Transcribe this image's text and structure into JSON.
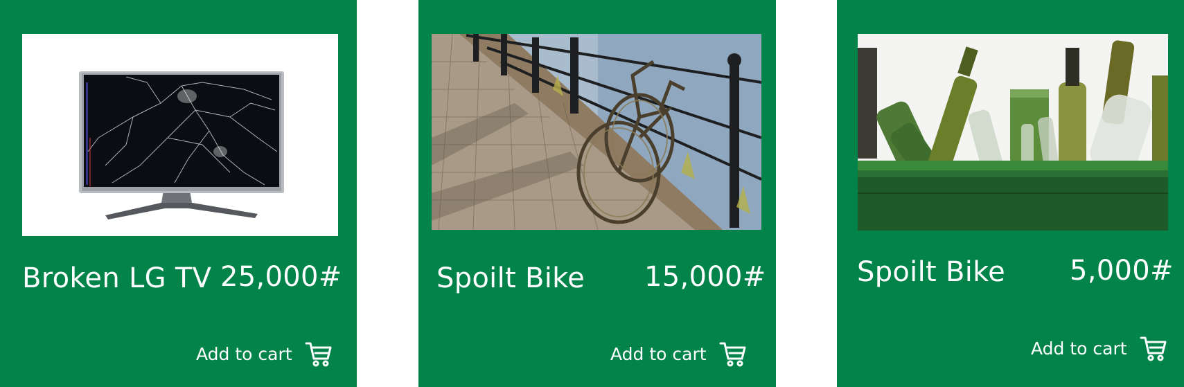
{
  "products": [
    {
      "name": "Broken LG TV",
      "price": "25,000#",
      "cart_label": "Add to cart",
      "image_subject": "broken-tv",
      "icon": "cart-icon"
    },
    {
      "name": "Spoilt Bike",
      "price": "15,000#",
      "cart_label": "Add to cart",
      "image_subject": "rusty-bike",
      "icon": "cart-icon"
    },
    {
      "name": "Spoilt Bike",
      "price": "5,000#",
      "cart_label": "Add to cart",
      "image_subject": "glass-bottles",
      "icon": "cart-icon"
    }
  ],
  "colors": {
    "card_background": "#018349",
    "page_background": "#ffffff",
    "text": "#ffffff"
  }
}
